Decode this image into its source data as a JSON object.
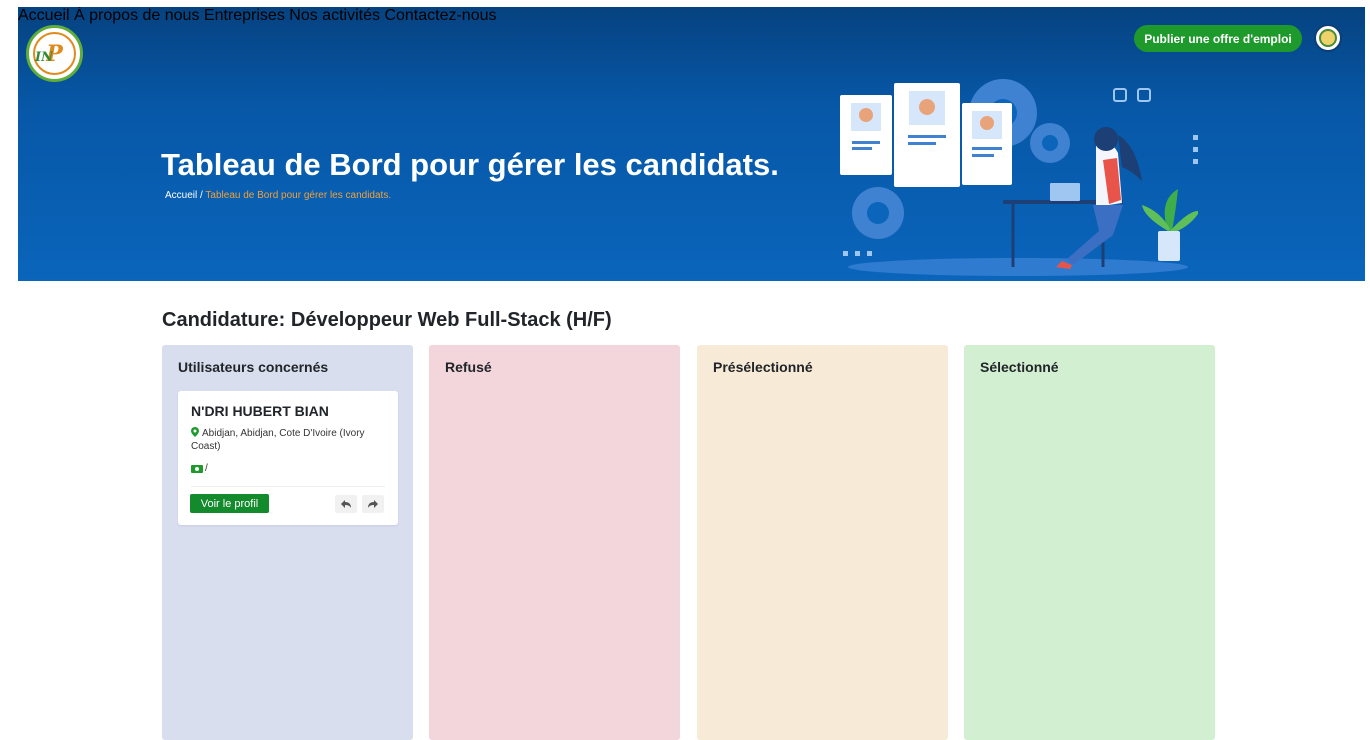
{
  "nav": {
    "links": [
      "Accueil",
      "À propos de nous",
      "Entreprises",
      "Nos activités",
      "Contactez-nous"
    ],
    "publish_label": "Publier une offre d'emploi"
  },
  "hero": {
    "title": "Tableau de Bord pour gérer les candidats.",
    "breadcrumb_home": "Accueil",
    "breadcrumb_sep": "/",
    "breadcrumb_current": "Tableau de Bord pour gérer les candidats."
  },
  "board": {
    "title": "Candidature: Développeur Web Full-Stack (H/F)",
    "columns": [
      {
        "title": "Utilisateurs concernés",
        "color": "#d9deef"
      },
      {
        "title": "Refusé",
        "color": "#f2d6dc"
      },
      {
        "title": "Présélectionné",
        "color": "#f7ead6"
      },
      {
        "title": "Sélectionné",
        "color": "#d3efd1"
      }
    ],
    "candidate": {
      "name": "N'DRI HUBERT BIAN",
      "location": "Abidjan, Abidjan, Cote D'Ivoire (Ivory Coast)",
      "salary": "/",
      "profile_button": "Voir le profil"
    }
  },
  "colors": {
    "hero_bg": "#0757a6",
    "accent_green": "#1e9a2c",
    "breadcrumb_active": "#f0a13c"
  }
}
